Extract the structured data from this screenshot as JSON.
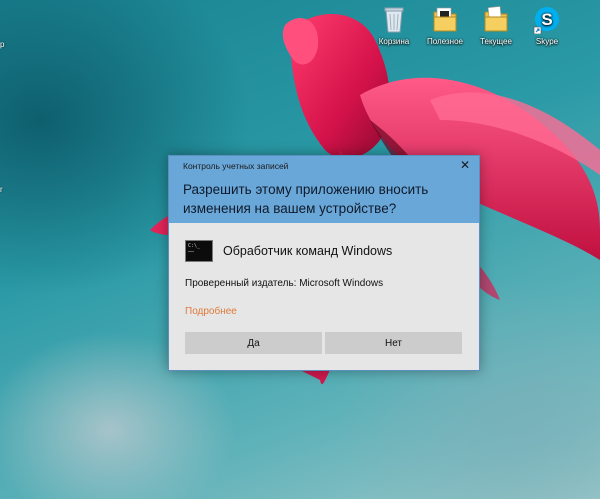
{
  "desktop": {
    "icons": [
      {
        "label": "Корзина",
        "icon": "recycle-bin-icon"
      },
      {
        "label": "Полезное",
        "icon": "folder-icon"
      },
      {
        "label": "Текущее",
        "icon": "folder-icon"
      },
      {
        "label": "Skype",
        "icon": "skype-icon"
      }
    ],
    "left_fragments": [
      "р",
      "r"
    ]
  },
  "uac": {
    "caption": "Контроль учетных записей",
    "close_glyph": "✕",
    "question": "Разрешить этому приложению вносить изменения на вашем устройстве?",
    "app_name": "Обработчик команд Windows",
    "publisher": "Проверенный издатель: Microsoft Windows",
    "details_link": "Подробнее",
    "yes_label": "Да",
    "no_label": "Нет",
    "colors": {
      "header": "#6aa7d9",
      "body": "#e6e6e6",
      "link": "#e07a3c",
      "button": "#cccccc"
    }
  }
}
